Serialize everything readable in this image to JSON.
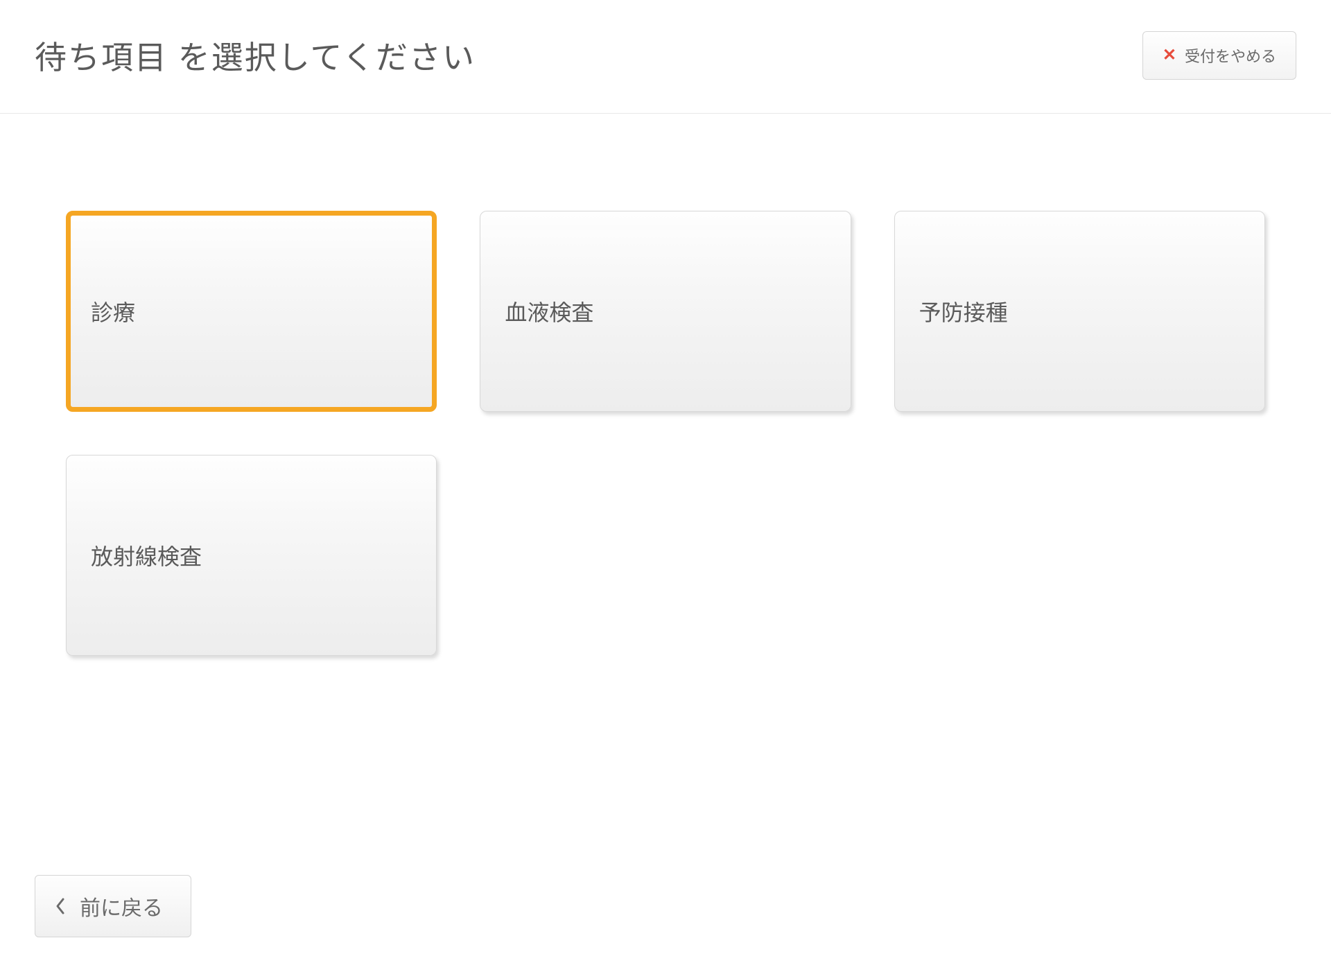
{
  "header": {
    "title": "待ち項目 を選択してください",
    "cancel_label": "受付をやめる"
  },
  "options": [
    {
      "label": "診療",
      "selected": true
    },
    {
      "label": "血液検査",
      "selected": false
    },
    {
      "label": "予防接種",
      "selected": false
    },
    {
      "label": "放射線検査",
      "selected": false
    }
  ],
  "footer": {
    "back_label": "前に戻る"
  }
}
